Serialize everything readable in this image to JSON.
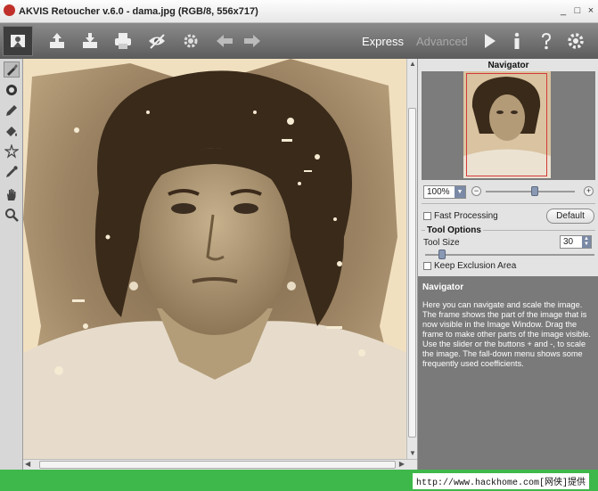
{
  "window": {
    "title": "AKVIS Retoucher v.6.0 - dama.jpg (RGB/8, 556x717)",
    "controls": [
      "_",
      "□",
      "×"
    ]
  },
  "toolbar": {
    "buttons": [
      "photo-icon",
      "open-icon",
      "save-icon",
      "print-icon",
      "eye-icon",
      "settings-gear-icon",
      "undo-icon",
      "redo-icon"
    ],
    "mode_express": "Express",
    "mode_advanced": "Advanced",
    "right_buttons": [
      "run-icon",
      "info-icon",
      "help-icon",
      "preferences-icon"
    ]
  },
  "tools": [
    "brush-icon",
    "eraser-icon",
    "pencil-icon",
    "fill-icon",
    "magic-icon",
    "dropper-icon",
    "hand-icon",
    "zoom-icon"
  ],
  "navigator": {
    "title": "Navigator",
    "zoom": "100%",
    "zoom_minus": "−",
    "zoom_plus": "+",
    "zoom_level": 0.55
  },
  "options": {
    "fast_processing": "Fast Processing",
    "default_button": "Default",
    "tool_options_title": "Tool Options",
    "tool_size_label": "Tool Size",
    "tool_size_value": "30",
    "keep_exclusion": "Keep Exclusion Area"
  },
  "help": {
    "title": "Navigator",
    "text": "Here you can navigate and scale the image. The frame shows the part of the image that is now visible in the Image Window. Drag the frame to make other parts of the image visible. Use the slider or the buttons + and -, to scale the image. The fall-down menu shows some frequently used coefficients."
  },
  "watermark": "http://www.hackhome.com[网侠]提供"
}
